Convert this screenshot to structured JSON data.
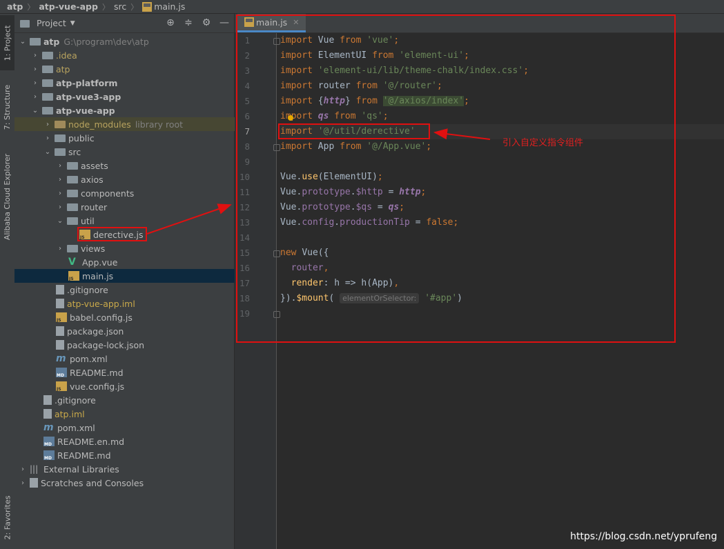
{
  "breadcrumb": {
    "items": [
      "atp",
      "atp-vue-app",
      "src",
      "main.js"
    ]
  },
  "left_tool_tabs": [
    "1: Project",
    "7: Structure",
    "Alibaba Cloud Explorer",
    "2: Favorites"
  ],
  "project_panel": {
    "title": "Project",
    "tree": [
      {
        "label": "atp",
        "sub": "G:\\program\\dev\\atp",
        "bold": true
      },
      {
        "label": ".idea"
      },
      {
        "label": "atp"
      },
      {
        "label": "atp-platform",
        "bold": true
      },
      {
        "label": "atp-vue3-app",
        "bold": true
      },
      {
        "label": "atp-vue-app",
        "bold": true
      },
      {
        "label": "node_modules",
        "sub": "library root"
      },
      {
        "label": "public"
      },
      {
        "label": "src"
      },
      {
        "label": "assets"
      },
      {
        "label": "axios"
      },
      {
        "label": "components"
      },
      {
        "label": "router"
      },
      {
        "label": "util"
      },
      {
        "label": "derective.js"
      },
      {
        "label": "views"
      },
      {
        "label": "App.vue"
      },
      {
        "label": "main.js"
      },
      {
        "label": ".gitignore"
      },
      {
        "label": "atp-vue-app.iml"
      },
      {
        "label": "babel.config.js"
      },
      {
        "label": "package.json"
      },
      {
        "label": "package-lock.json"
      },
      {
        "label": "pom.xml"
      },
      {
        "label": "README.md"
      },
      {
        "label": "vue.config.js"
      },
      {
        "label": ".gitignore"
      },
      {
        "label": "atp.iml"
      },
      {
        "label": "pom.xml"
      },
      {
        "label": "README.en.md"
      },
      {
        "label": "README.md"
      },
      {
        "label": "External Libraries"
      },
      {
        "label": "Scratches and Consoles"
      }
    ]
  },
  "editor": {
    "tab": "main.js",
    "line_numbers": [
      "1",
      "2",
      "3",
      "4",
      "5",
      "6",
      "7",
      "8",
      "9",
      "10",
      "11",
      "12",
      "13",
      "14",
      "15",
      "16",
      "17",
      "18",
      "19"
    ],
    "current_line": 7,
    "lines": [
      "import Vue from 'vue';",
      "import ElementUI from 'element-ui';",
      "import 'element-ui/lib/theme-chalk/index.css';",
      "import router from '@/router';",
      "import {http} from '@/axios/index';",
      "import qs from 'qs';",
      "import '@/util/derective'",
      "import App from '@/App.vue';",
      "",
      "Vue.use(ElementUI);",
      "Vue.prototype.$http = http;",
      "Vue.prototype.$qs = qs;",
      "Vue.config.productionTip = false;",
      "",
      "new Vue({",
      "  router,",
      "  render: h => h(App),",
      "}).$mount( elementOrSelector: '#app')",
      ""
    ],
    "param_hint": "elementOrSelector:"
  },
  "annotation": {
    "text": "引入自定义指令组件",
    "color": "#e02020"
  },
  "watermark": "https://blog.csdn.net/yprufeng"
}
